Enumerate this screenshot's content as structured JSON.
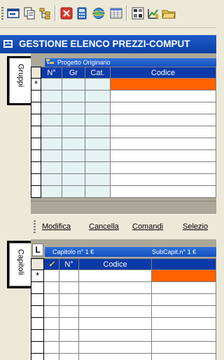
{
  "title": "GESTIONE ELENCO PREZZI-COMPUT",
  "toolbar": {
    "icons": [
      "window-icon",
      "copy-icon",
      "tree-icon",
      "close-red-icon",
      "calculator-icon",
      "globe-icon",
      "table-icon",
      "chart-icon",
      "image-icon",
      "folder-icon"
    ]
  },
  "tabs": {
    "gruppi": "Gruppi",
    "capitoli": "Capitoli"
  },
  "upper_grid": {
    "subheader": "Progetto Originario",
    "columns": [
      "N°",
      "Gr",
      "Cat.",
      "Codice"
    ],
    "new_row_marker": "*"
  },
  "menu": {
    "items": [
      "Modifica",
      "Cancella",
      "Comandi",
      "Selezio"
    ]
  },
  "lower_grid": {
    "corner": "L",
    "subheader_left": "Capitolo n° 1 €",
    "subheader_right": "SubCapit.n° 1 €",
    "columns": [
      "N°",
      "Codice"
    ],
    "new_row_marker": "*"
  },
  "colors": {
    "header_blue": "#0b3aa8",
    "selection_orange": "#ff6200",
    "window_bg": "#ece9d8"
  }
}
